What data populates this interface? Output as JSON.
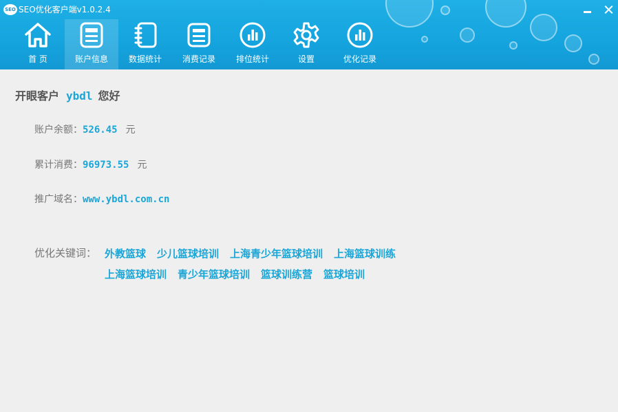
{
  "window": {
    "logo_text": "SEO",
    "title": "SEO优化客户端v1.0.2.4"
  },
  "nav": [
    {
      "label": "首  页",
      "icon": "home-icon",
      "active": false
    },
    {
      "label": "账户信息",
      "icon": "account-card-icon",
      "active": true
    },
    {
      "label": "数据统计",
      "icon": "notebook-icon",
      "active": false
    },
    {
      "label": "消费记录",
      "icon": "document-list-icon",
      "active": false
    },
    {
      "label": "排位统计",
      "icon": "bar-chart-icon",
      "active": false
    },
    {
      "label": "设置",
      "icon": "gear-icon",
      "active": false
    },
    {
      "label": "优化记录",
      "icon": "bar-chart-icon",
      "active": false
    }
  ],
  "greeting": {
    "prefix": "开眼客户",
    "username": "ybdl",
    "suffix": "您好"
  },
  "account": {
    "balance_label": "账户余额：",
    "balance_value": "526.45",
    "balance_unit": "元",
    "spent_label": "累计消费：",
    "spent_value": "96973.55",
    "spent_unit": "元",
    "domain_label": "推广域名：",
    "domain_value": "www.ybdl.com.cn"
  },
  "keywords": {
    "label": "优化关键词：",
    "items": [
      "外教篮球",
      "少儿篮球培训",
      "上海青少年篮球培训",
      "上海篮球训练",
      "上海篮球培训",
      "青少年篮球培训",
      "篮球训练营",
      "篮球培训"
    ]
  },
  "colors": {
    "header": "#15a4de",
    "accent": "#1aa6d8",
    "background": "#efefef"
  }
}
